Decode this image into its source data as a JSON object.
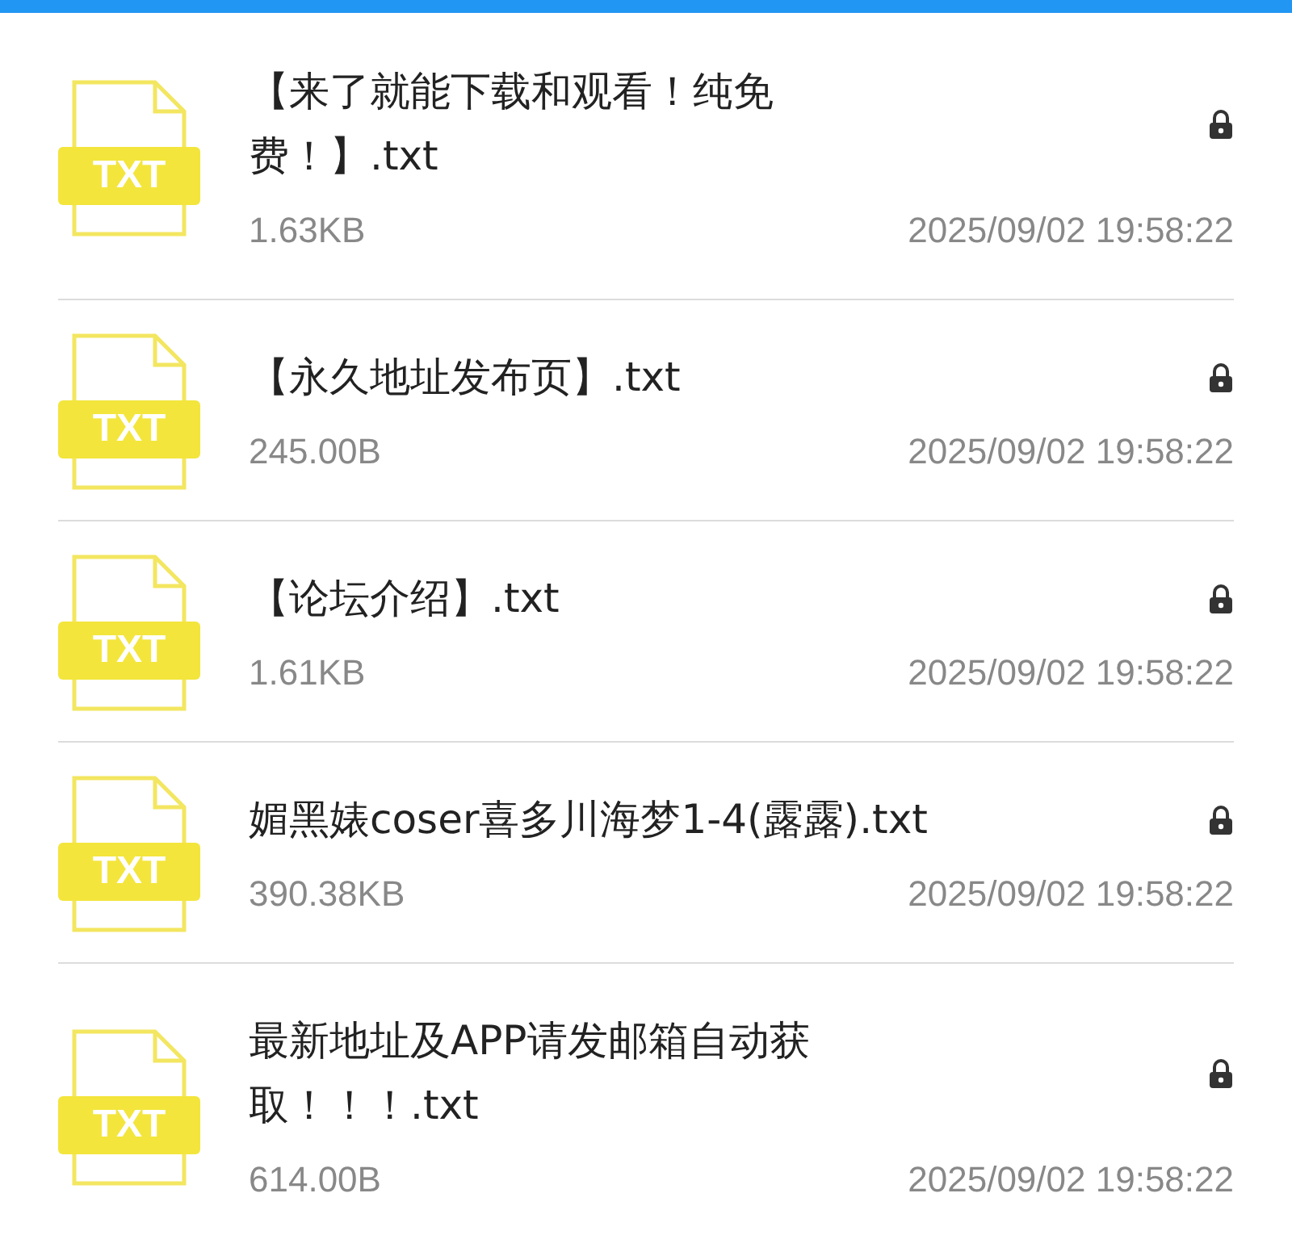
{
  "files": [
    {
      "name": "【来了就能下载和观看！纯免费！】.txt",
      "badge": "TXT",
      "size": "1.63KB",
      "date": "2025/09/02 19:58:22",
      "locked": true
    },
    {
      "name": "【永久地址发布页】.txt",
      "badge": "TXT",
      "size": "245.00B",
      "date": "2025/09/02 19:58:22",
      "locked": true
    },
    {
      "name": "【论坛介绍】.txt",
      "badge": "TXT",
      "size": "1.61KB",
      "date": "2025/09/02 19:58:22",
      "locked": true
    },
    {
      "name": "媚黑婊coser喜多川海梦1-4(露露).txt",
      "badge": "TXT",
      "size": "390.38KB",
      "date": "2025/09/02 19:58:22",
      "locked": true
    },
    {
      "name": "最新地址及APP请发邮箱自动获取！！！.txt",
      "badge": "TXT",
      "size": "614.00B",
      "date": "2025/09/02 19:58:22",
      "locked": true
    }
  ]
}
